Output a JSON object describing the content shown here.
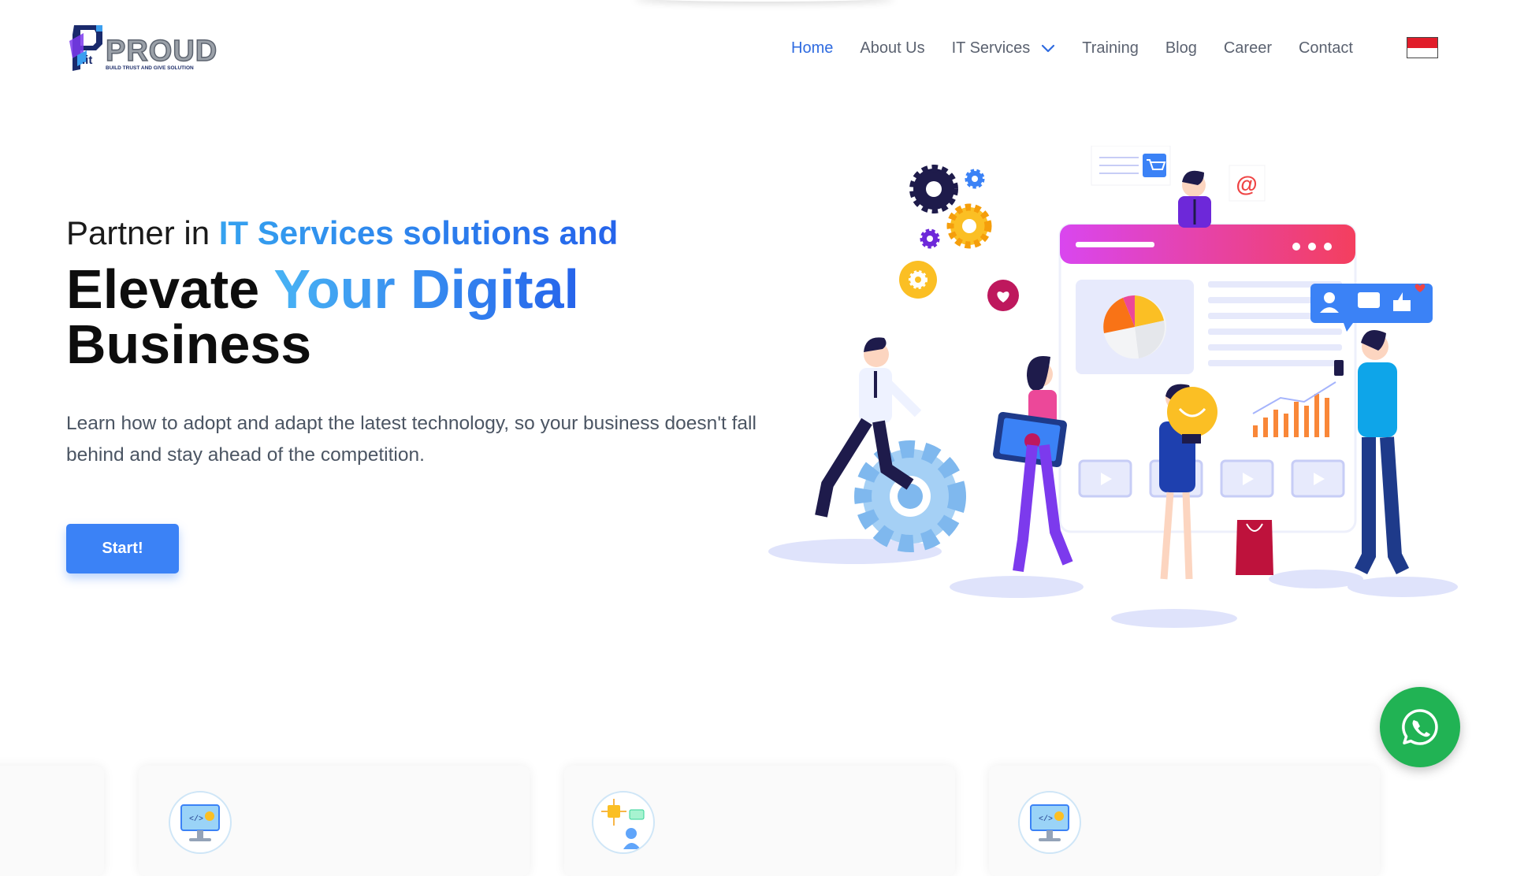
{
  "brand": {
    "name": "PROUD",
    "suffix": ".it",
    "tagline": "BUILD TRUST AND GIVE SOLUTION"
  },
  "nav": {
    "items": [
      {
        "label": "Home",
        "active": true
      },
      {
        "label": "About Us"
      },
      {
        "label": "IT Services",
        "has_dropdown": true
      },
      {
        "label": "Training"
      },
      {
        "label": "Blog"
      },
      {
        "label": "Career"
      },
      {
        "label": "Contact"
      }
    ],
    "language_flag": "indonesia-flag"
  },
  "hero": {
    "pre_plain": "Partner in ",
    "pre_accent": "IT Services solutions and",
    "title_plain": "Elevate ",
    "title_accent": "Your Digital",
    "title_line2": "Business",
    "description": "Learn how to adopt and adapt the latest technology, so your business doesn't fall behind and stay ahead of the competition.",
    "cta_label": "Start!"
  },
  "floating": {
    "whatsapp_icon": "whatsapp-icon"
  },
  "cards": [
    {
      "icon": "monitor-code-icon"
    },
    {
      "icon": "monitor-code-icon"
    },
    {
      "icon": "ai-network-icon"
    },
    {
      "icon": "monitor-code-icon"
    }
  ],
  "colors": {
    "accent": "#2f6be0",
    "button": "#3b82f6",
    "whatsapp": "#21b354",
    "text": "#1a1a1a"
  }
}
